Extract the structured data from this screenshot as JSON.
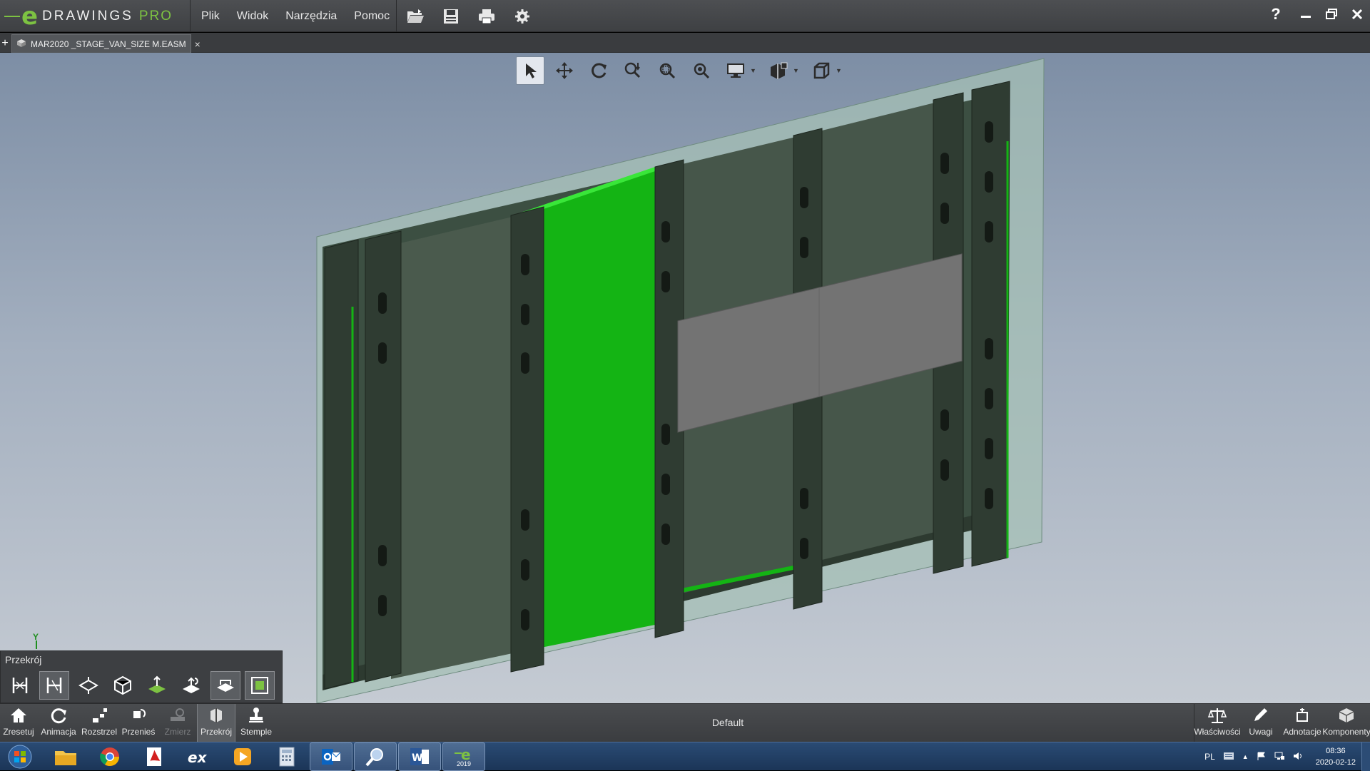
{
  "app": {
    "logo_mark": "e",
    "logo_name": "DRAWINGS",
    "logo_edition": "PRO",
    "menu": [
      "Plik",
      "Widok",
      "Narzędzia",
      "Pomoc"
    ],
    "quick_icons": [
      "open-icon",
      "save-icon",
      "print-icon",
      "settings-icon"
    ],
    "help_label": "?",
    "window_controls": [
      "minimize-icon",
      "restore-icon",
      "close-icon"
    ]
  },
  "tabs": {
    "add_label": "+",
    "document": "MAR2020 _STAGE_VAN_SIZE M.EASM",
    "close_label": "×"
  },
  "view_toolbar": {
    "tools": [
      "select-icon",
      "pan-icon",
      "rotate-icon",
      "zoom-fit-icon",
      "zoom-area-icon",
      "zoom-icon",
      "display-style-icon",
      "shaded-icon",
      "view-orientation-icon"
    ]
  },
  "section_panel": {
    "title": "Przekrój",
    "tools": [
      "section-xy-icon",
      "section-yz-icon",
      "section-xz-icon",
      "section-box-icon",
      "section-plane-flip-icon",
      "section-plane-offset-icon",
      "section-cap-icon",
      "section-fill-icon"
    ]
  },
  "axis": {
    "label": "Y"
  },
  "bottom_toolbar": {
    "left": [
      {
        "icon": "home-icon",
        "label": "Zresetuj",
        "enabled": true
      },
      {
        "icon": "animation-icon",
        "label": "Animacja",
        "enabled": true
      },
      {
        "icon": "explode-icon",
        "label": "Rozstrzel",
        "enabled": true
      },
      {
        "icon": "move-icon",
        "label": "Przenieś",
        "enabled": true
      },
      {
        "icon": "measure-icon",
        "label": "Zmierz",
        "enabled": false
      },
      {
        "icon": "section-icon",
        "label": "Przekrój",
        "enabled": true
      },
      {
        "icon": "stamp-icon",
        "label": "Stemple",
        "enabled": true
      }
    ],
    "configuration": "Default",
    "right": [
      {
        "icon": "properties-icon",
        "label": "Właściwości"
      },
      {
        "icon": "markup-icon",
        "label": "Uwagi"
      },
      {
        "icon": "annotations-icon",
        "label": "Adnotacje"
      },
      {
        "icon": "components-icon",
        "label": "Komponenty"
      }
    ]
  },
  "taskbar": {
    "apps": [
      "explorer-icon",
      "chrome-icon",
      "acrobat-icon",
      "excel-icon",
      "media-player-icon",
      "calculator-icon",
      "outlook-icon",
      "search-icon",
      "word-icon",
      "edrawings-icon"
    ],
    "edrawings_badge": "2019",
    "language": "PL",
    "time": "08:36",
    "date": "2020-02-12"
  },
  "colors": {
    "accent_green": "#7dc242",
    "highlight_green": "#14b414",
    "panel_dark": "#3d5244",
    "panel_gray": "#727272",
    "glass": "#a9c4b8"
  }
}
